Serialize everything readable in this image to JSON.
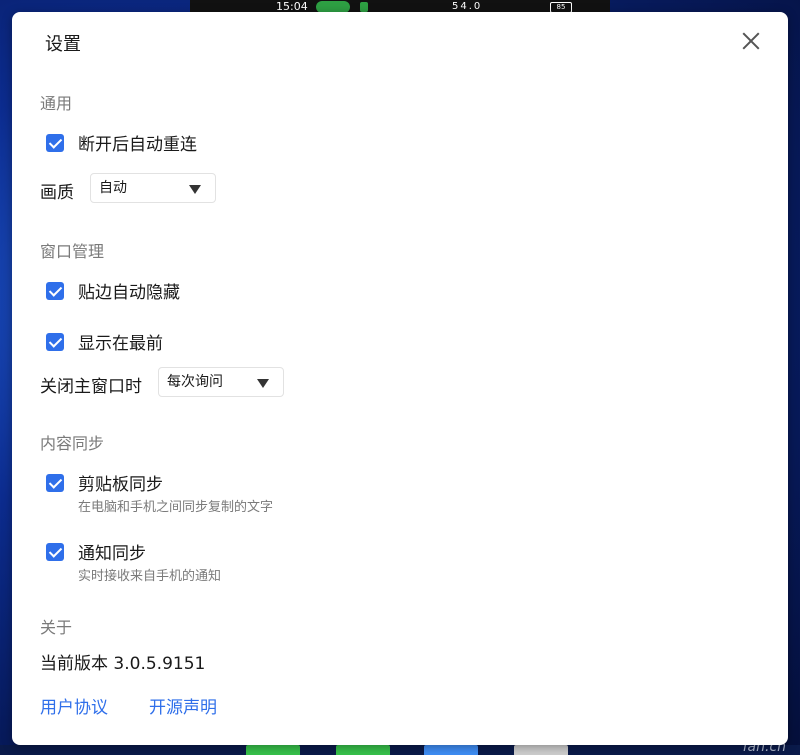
{
  "statusbar": {
    "time": "15:04",
    "battery": "85",
    "signal": "54.0"
  },
  "dialog": {
    "title": "设置",
    "general": {
      "heading": "通用",
      "auto_reconnect": "断开后自动重连",
      "quality_label": "画质",
      "quality_value": "自动"
    },
    "window": {
      "heading": "窗口管理",
      "edge_hide": "贴边自动隐藏",
      "always_on_top": "显示在最前",
      "close_main_label": "关闭主窗口时",
      "close_main_value": "每次询问"
    },
    "sync": {
      "heading": "内容同步",
      "clipboard": "剪贴板同步",
      "clipboard_desc": "在电脑和手机之间同步复制的文字",
      "notification": "通知同步",
      "notification_desc": "实时接收来自手机的通知"
    },
    "about": {
      "heading": "关于",
      "version": "当前版本 3.0.5.9151",
      "user_agreement": "用户协议",
      "open_source": "开源声明"
    }
  },
  "colors": {
    "accent": "#2f6fea"
  },
  "watermark": "fan.cn"
}
